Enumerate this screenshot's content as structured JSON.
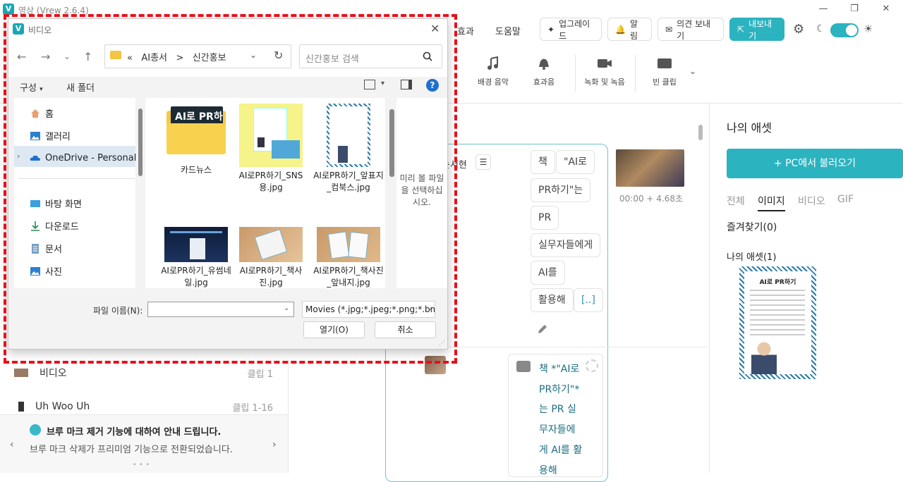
{
  "app": {
    "title": "영상 (Vrew 2.6.4)",
    "logo": "V",
    "menu": [
      "효과",
      "도움말"
    ],
    "buttons": {
      "upgrade": "업그레이드",
      "notify": "알림",
      "feedback": "의견 보내기",
      "export": "내보내기"
    },
    "accent_color": "#2bb3c0"
  },
  "ribbon": {
    "items": [
      {
        "label": "배경 음악",
        "icon": "music-icon"
      },
      {
        "label": "효과음",
        "icon": "bell-icon"
      },
      {
        "label": "녹화 및 녹음",
        "icon": "video-camera-icon"
      },
      {
        "label": "빈 클립",
        "icon": "blank-clip-icon"
      }
    ]
  },
  "editor": {
    "speaker": "는서현",
    "words": [
      "책",
      "\"AI로",
      "PR하기\"는",
      "PR",
      "실무자들에게",
      "AI를",
      "활용해",
      "[..]"
    ],
    "timecode": "00:00 + 4.68초",
    "caption": "책 *\"AI로 PR하기\"* 는 PR 실 무자들에 게 AI를 활용해"
  },
  "left_list": [
    {
      "label": "비디오",
      "right": "클립 1"
    },
    {
      "label": "Uh Woo Uh",
      "right": "클립 1-16"
    }
  ],
  "notice": {
    "title": "브루 마크 제거 기능에 대하여 안내 드립니다.",
    "body": "브루 마크 삭제가 프리미엄 기능으로 전환되었습니다."
  },
  "assets": {
    "title": "나의 애셋",
    "load_button": "+ PC에서 불러오기",
    "tabs": [
      "전체",
      "이미지",
      "비디오",
      "GIF"
    ],
    "active_tab": "이미지",
    "favorites": "즐겨찾기(0)",
    "my_assets": "나의 애셋(1)",
    "thumb_title": "AI로 PR하기"
  },
  "dialog": {
    "title": "비디오",
    "path_prefix": "«",
    "path": [
      "AI총서",
      "신간홍보"
    ],
    "path_sep": ">",
    "search_placeholder": "신간홍보 검색",
    "organize": "구성",
    "new_folder": "새 폴더",
    "help": "?",
    "nav": [
      {
        "label": "홈",
        "icon": "home-icon",
        "pinned": false
      },
      {
        "label": "갤러리",
        "icon": "gallery-icon",
        "pinned": false
      },
      {
        "label": "OneDrive - Personal",
        "icon": "cloud-icon",
        "pinned": false,
        "selected": true
      },
      {
        "label": "바탕 화면",
        "icon": "desktop-icon",
        "pinned": true
      },
      {
        "label": "다운로드",
        "icon": "download-icon",
        "pinned": true
      },
      {
        "label": "문서",
        "icon": "document-icon",
        "pinned": true
      },
      {
        "label": "사진",
        "icon": "pictures-icon",
        "pinned": true
      }
    ],
    "files": [
      {
        "name": "카드뉴스",
        "kind": "folder",
        "folder_text": "AI로 PR하기"
      },
      {
        "name": "AI로PR하기_SNS용.jpg",
        "kind": "image"
      },
      {
        "name": "AI로PR하기_앞표지_컴북스.jpg",
        "kind": "image"
      },
      {
        "name": "AI로PR하기_유썸네일.jpg",
        "kind": "image"
      },
      {
        "name": "AI로PR하기_책사진.jpg",
        "kind": "image"
      },
      {
        "name": "AI로PR하기_책사진_앞내지.jpg",
        "kind": "image"
      }
    ],
    "preview_text": "미리 볼 파일을 선택하십시오.",
    "filename_label": "파일 이름(N):",
    "filename_value": "",
    "filetype": "Movies (*.jpg;*.jpeg;*.png;*.bm",
    "open_button": "열기(O)",
    "cancel_button": "취소"
  },
  "highlight_color": "#e8101a"
}
